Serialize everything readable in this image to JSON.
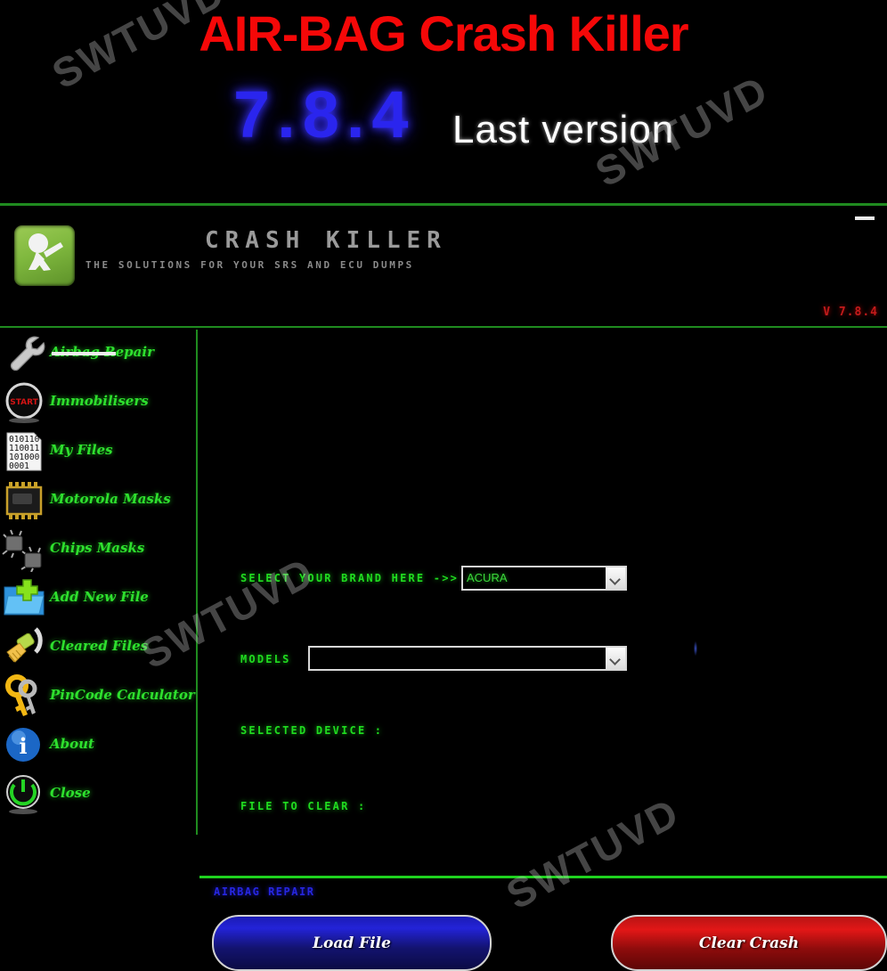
{
  "banner": {
    "title": "AIR-BAG Crash Killer",
    "version_number": "7.8.4",
    "version_note": "Last version"
  },
  "app": {
    "brand_title": "CRASH KILLER",
    "brand_tagline": "THE SOLUTIONS FOR YOUR SRS AND ECU DUMPS",
    "version_label": "V 7.8.4",
    "minimize_label": "",
    "logo_icon": "crash-dummy-icon"
  },
  "sidebar": {
    "items": [
      {
        "label": "Airbag Repair",
        "icon": "wrench-icon",
        "struck_through": true
      },
      {
        "label": "Immobilisers",
        "icon": "start-button-icon",
        "struck_through": false
      },
      {
        "label": "My Files",
        "icon": "binary-file-icon",
        "struck_through": false
      },
      {
        "label": "Motorola Masks",
        "icon": "microchip-icon",
        "struck_through": false
      },
      {
        "label": "Chips Masks",
        "icon": "chips-icon",
        "struck_through": false
      },
      {
        "label": "Add New File",
        "icon": "add-folder-icon",
        "struck_through": false
      },
      {
        "label": "Cleared Files",
        "icon": "broom-icon",
        "struck_through": false
      },
      {
        "label": "PinCode Calculator",
        "icon": "keys-icon",
        "struck_through": false
      },
      {
        "label": "About",
        "icon": "info-icon",
        "struck_through": false
      },
      {
        "label": "Close",
        "icon": "power-icon",
        "struck_through": false
      }
    ]
  },
  "main": {
    "brand_label": "SELECT YOUR BRAND HERE ->>",
    "brand_value": "ACURA",
    "models_label": "MODELS",
    "models_value": "",
    "selected_device_label": "SELECTED DEVICE :",
    "selected_device_value": "",
    "file_to_clear_label": "FILE TO CLEAR :",
    "file_to_clear_value": "",
    "load_button": "Load File",
    "clear_button": "Clear Crash",
    "status_text": "AIRBAG REPAIR"
  },
  "watermark": {
    "text": "SWTUVD"
  },
  "colors": {
    "accent_green": "#1fd31f",
    "banner_red": "#f50808",
    "banner_blue": "#2a25ee",
    "label_green": "#20dc20",
    "load_blue": "#1b1bb4",
    "clear_red": "#e21717",
    "status_blue": "#2626e0"
  }
}
